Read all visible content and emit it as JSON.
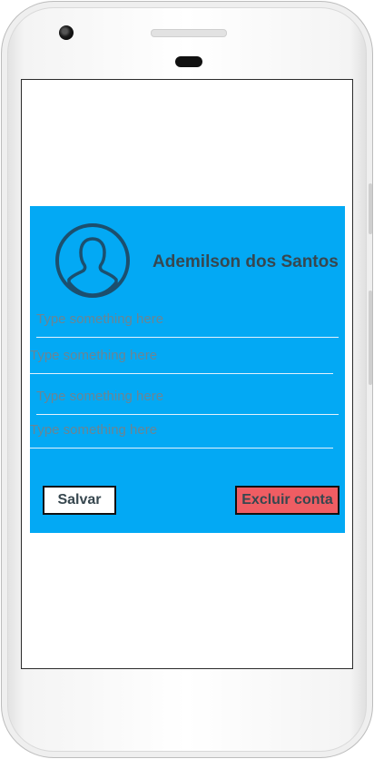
{
  "profile": {
    "name": "Ademilson dos Santos"
  },
  "form": {
    "fields": [
      {
        "value": "",
        "placeholder": "Type something here"
      },
      {
        "value": "",
        "placeholder": "Type something here"
      },
      {
        "value": "",
        "placeholder": "Type something here"
      },
      {
        "value": "",
        "placeholder": "Type something here"
      }
    ]
  },
  "actions": {
    "save_label": "Salvar",
    "delete_label": "Excluir conta"
  },
  "icons": {
    "avatar": "user-avatar-icon"
  },
  "colors": {
    "card_background": "#03a9f4",
    "delete_button": "#ef5d63",
    "text": "#37474f"
  }
}
